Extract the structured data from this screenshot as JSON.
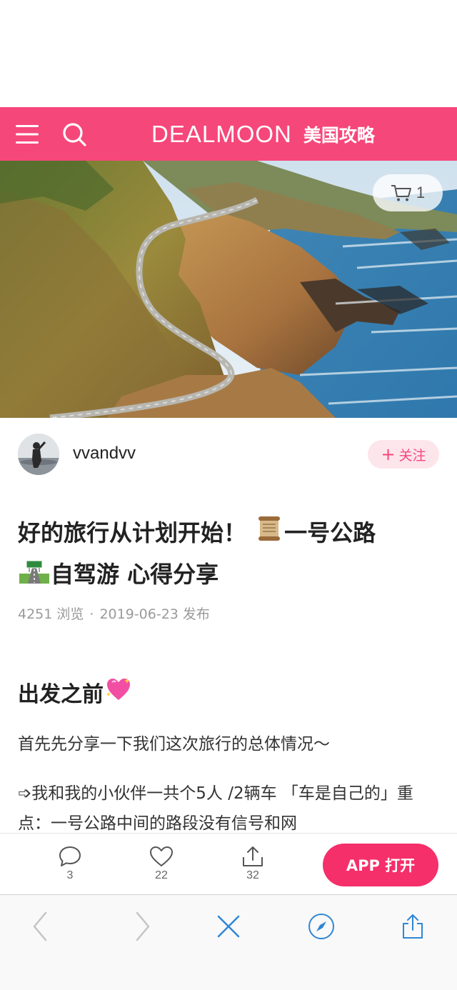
{
  "header": {
    "brand_name": "DEALMOON",
    "brand_sub": "美国攻略"
  },
  "hero": {
    "cart_count": "1"
  },
  "author": {
    "username": "vvandvv",
    "follow_label": "关注"
  },
  "article": {
    "title_part1": "好的旅行从计划开始！",
    "title_part2": "一号公路",
    "title_part3": "自驾游 心得分享",
    "views": "4251 浏览",
    "separator": "·",
    "published": "2019-06-23 发布",
    "section_heading": "出发之前",
    "para1": "首先先分享一下我们这次旅行的总体情况～",
    "para2": "➩我和我的小伙伴一共个5人 /2辆车 「车是自己的」重点：一号公路中间的路段没有信号和网"
  },
  "actions": {
    "comments": "3",
    "likes": "22",
    "shares": "32",
    "app_open_label": "APP 打开"
  },
  "colors": {
    "brand": "#f6477a",
    "app_button": "#f52f6a",
    "browser_icon": "#2f86d6"
  },
  "icons": [
    "menu-icon",
    "search-icon",
    "cart-icon",
    "plus-icon",
    "scroll-emoji",
    "motorway-emoji",
    "sparkling-heart-emoji",
    "comment-icon",
    "heart-icon",
    "share-icon",
    "back-icon",
    "forward-icon",
    "close-icon",
    "compass-icon",
    "upload-icon"
  ]
}
